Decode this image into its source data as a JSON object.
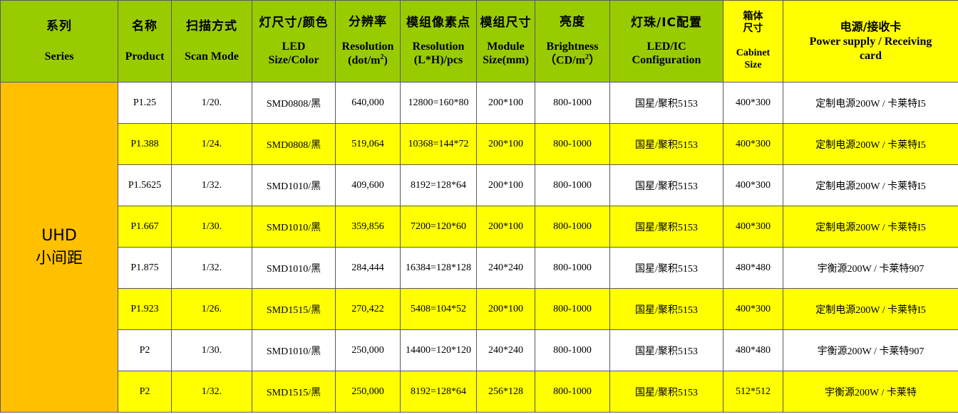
{
  "headers": {
    "series": {
      "zh": "系列",
      "en": "Series"
    },
    "product": {
      "zh": "名称",
      "en": "Product"
    },
    "scan": {
      "zh": "扫描方式",
      "en": "Scan Mode"
    },
    "led_size": {
      "zh": "灯尺寸/颜色",
      "en1": "LED",
      "en2": "Size/Color"
    },
    "resolution_dot": {
      "zh": "分辨率",
      "en1": "Resolution",
      "en2": "(dot/m",
      "sup": "2",
      "en3": ")"
    },
    "module_pixels": {
      "zh": "模组像素点",
      "en1": "Resolution",
      "en2": "(L*H)/pcs"
    },
    "module_size": {
      "zh": "模组尺寸",
      "en1": "Module",
      "en2": "Size(mm)"
    },
    "brightness": {
      "zh": "亮度",
      "en1": "Brightness",
      "en2": "（CD/m",
      "sup": "2",
      "en3": "）"
    },
    "led_ic": {
      "zh": "灯珠/IC配置",
      "en1": "LED/IC",
      "en2": "Configuration"
    },
    "cabinet": {
      "zh1": "箱体",
      "zh2": "尺寸",
      "en1": "Cabinet",
      "en2": "Size"
    },
    "power": {
      "zh": "电源/接收卡",
      "en1": "Power supply / Receiving",
      "en2": "card"
    }
  },
  "series_label": {
    "line1": "UHD",
    "line2": "小间距"
  },
  "rows": [
    {
      "product": "P1.25",
      "scan": "1/20.",
      "led": "SMD0808/黑",
      "res": "640,000",
      "pixels": "12800=160*80",
      "module": "200*100",
      "bright": "800-1000",
      "ic": "国星/聚积5153",
      "cabinet": "400*300",
      "power": "定制电源200W / 卡莱特I5"
    },
    {
      "product": "P1.388",
      "scan": "1/24.",
      "led": "SMD0808/黑",
      "res": "519,064",
      "pixels": "10368=144*72",
      "module": "200*100",
      "bright": "800-1000",
      "ic": "国星/聚积5153",
      "cabinet": "400*300",
      "power": "定制电源200W / 卡莱特I5"
    },
    {
      "product": "P1.5625",
      "scan": "1/32.",
      "led": "SMD1010/黑",
      "res": "409,600",
      "pixels": "8192=128*64",
      "module": "200*100",
      "bright": "800-1000",
      "ic": "国星/聚积5153",
      "cabinet": "400*300",
      "power": "定制电源200W / 卡莱特I5"
    },
    {
      "product": "P1.667",
      "scan": "1/30.",
      "led": "SMD1010/黑",
      "res": "359,856",
      "pixels": "7200=120*60",
      "module": "200*100",
      "bright": "800-1000",
      "ic": "国星/聚积5153",
      "cabinet": "400*300",
      "power": "定制电源200W / 卡莱特I5"
    },
    {
      "product": "P1.875",
      "scan": "1/32.",
      "led": "SMD1010/黑",
      "res": "284,444",
      "pixels": "16384=128*128",
      "module": "240*240",
      "bright": "800-1000",
      "ic": "国星/聚积5153",
      "cabinet": "480*480",
      "power": "宇衡源200W / 卡莱特907"
    },
    {
      "product": "P1.923",
      "scan": "1/26.",
      "led": "SMD1515/黑",
      "res": "270,422",
      "pixels": "5408=104*52",
      "module": "200*100",
      "bright": "800-1000",
      "ic": "国星/聚积5153",
      "cabinet": "400*300",
      "power": "定制电源200W / 卡莱特I5"
    },
    {
      "product": "P2",
      "scan": "1/30.",
      "led": "SMD1010/黑",
      "res": "250,000",
      "pixels": "14400=120*120",
      "module": "240*240",
      "bright": "800-1000",
      "ic": "国星/聚积5153",
      "cabinet": "480*480",
      "power": "宇衡源200W / 卡莱特907"
    },
    {
      "product": "P2",
      "scan": "1/32.",
      "led": "SMD1515/黑",
      "res": "250,000",
      "pixels": "8192=128*64",
      "module": "256*128",
      "bright": "800-1000",
      "ic": "国星/聚积5153",
      "cabinet": "512*512",
      "power": "宇衡源200W / 卡莱特"
    }
  ],
  "colors": {
    "header_green": "#99cc00",
    "header_yellow": "#ffff00",
    "series_orange": "#ffc000",
    "row_highlight": "#ffff00"
  }
}
